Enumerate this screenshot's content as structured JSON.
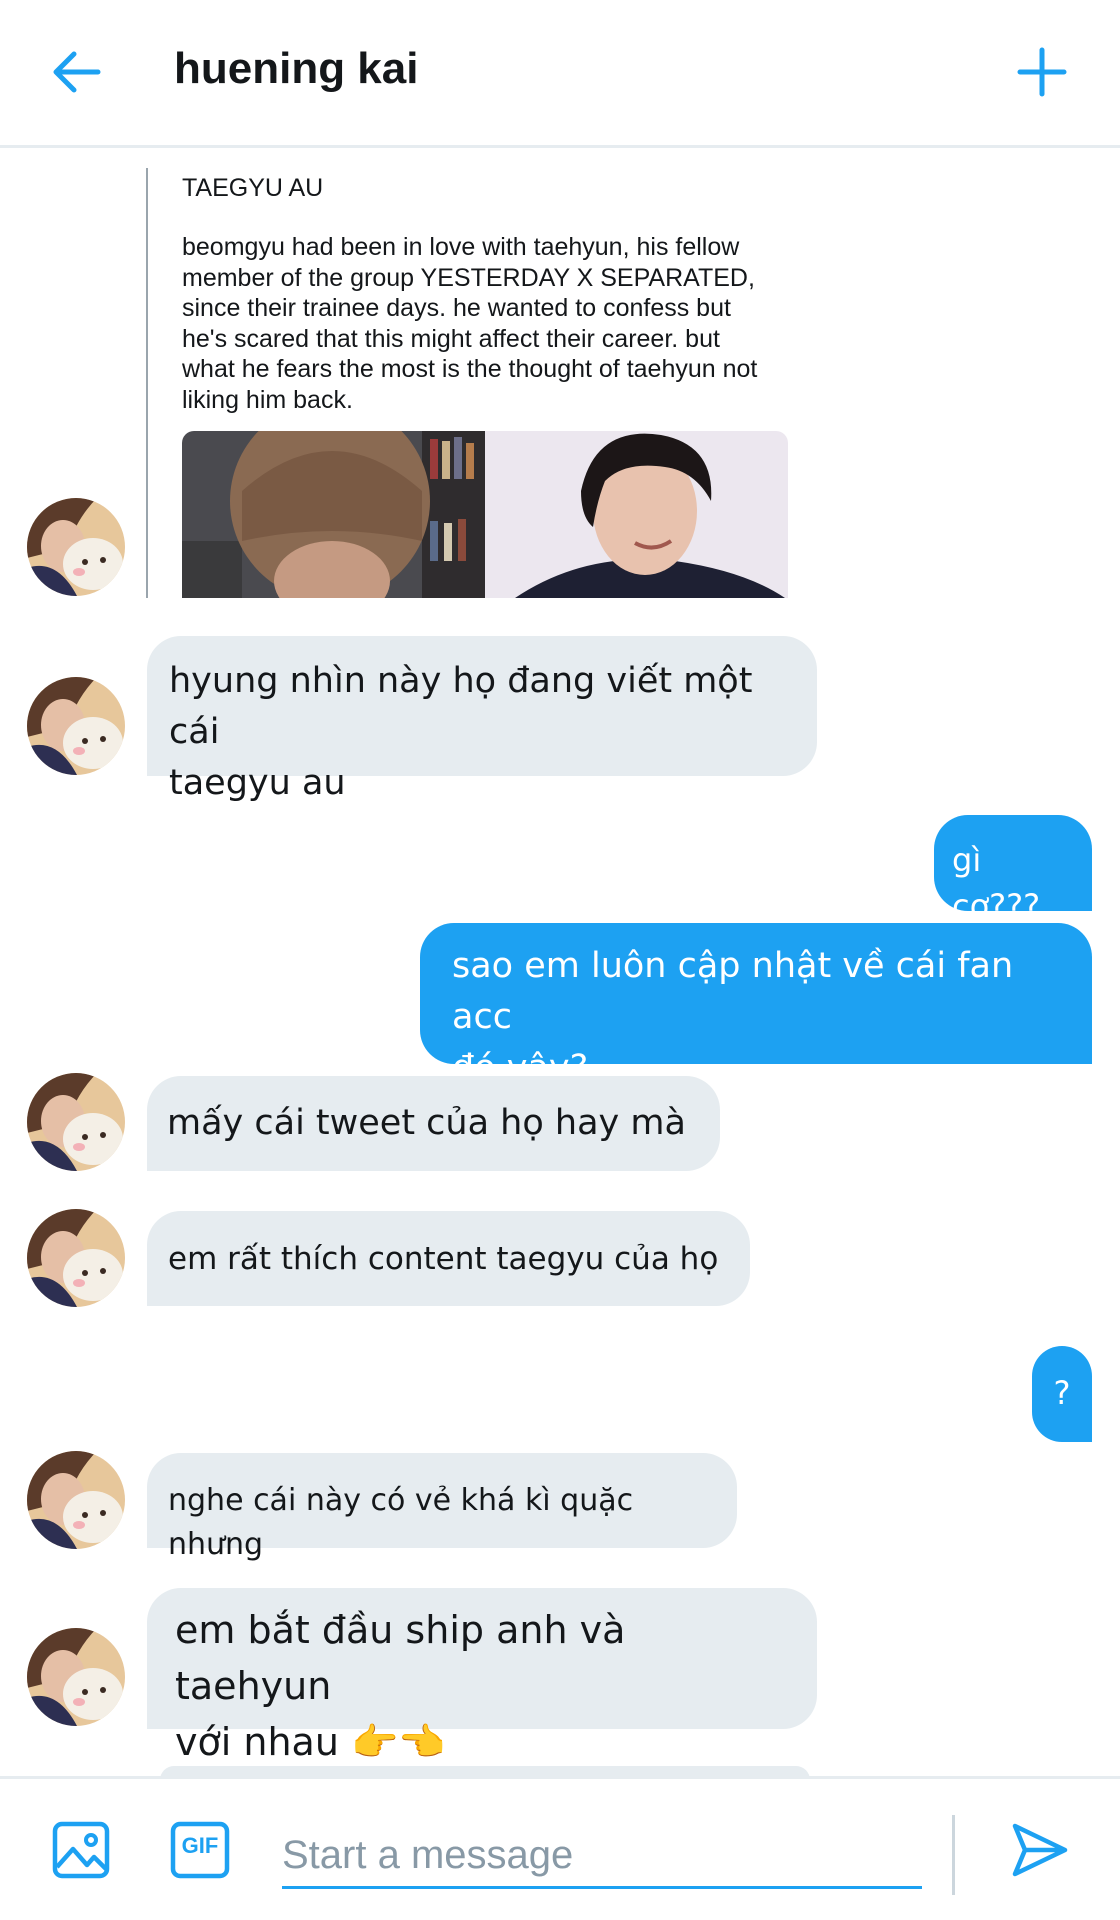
{
  "header": {
    "title": "huening kai",
    "back_icon": "arrow-left-icon",
    "add_icon": "plus-icon"
  },
  "quote": {
    "title": "TAEGYU AU",
    "body_lines": [
      "beomgyu had been in love with taehyun, his fellow",
      "member of the group YESTERDAY X SEPARATED,",
      "since their trainee days. he wanted to confess but",
      "he's scared that this might affect their career. but",
      "what he fears the most is the thought of taehyun not",
      "liking him back."
    ]
  },
  "messages": [
    {
      "lines": [
        "hyung nhìn này họ đang viết một cái",
        "taegyu au"
      ]
    },
    {
      "lines": [
        "gì cơ???"
      ]
    },
    {
      "lines": [
        "sao em luôn cập nhật về cái fan acc",
        "đó vậy?"
      ]
    },
    {
      "lines": [
        "mấy cái tweet của họ hay mà"
      ]
    },
    {
      "lines": [
        "em rất thích content taegyu của họ"
      ]
    },
    {
      "lines": [
        "?"
      ]
    },
    {
      "lines": [
        "nghe cái này có vẻ khá kì quặc nhưng"
      ]
    },
    {
      "lines": [
        "em bắt đầu ship anh và taehyun",
        "với nhau 👉👈"
      ]
    }
  ],
  "composer": {
    "placeholder": "Start a message",
    "gif_label": "GIF",
    "media_icon": "image-icon",
    "send_icon": "send-icon"
  },
  "colors": {
    "accent": "#1da1f2",
    "incoming_bubble": "#e6ecf0",
    "text": "#14171a"
  }
}
